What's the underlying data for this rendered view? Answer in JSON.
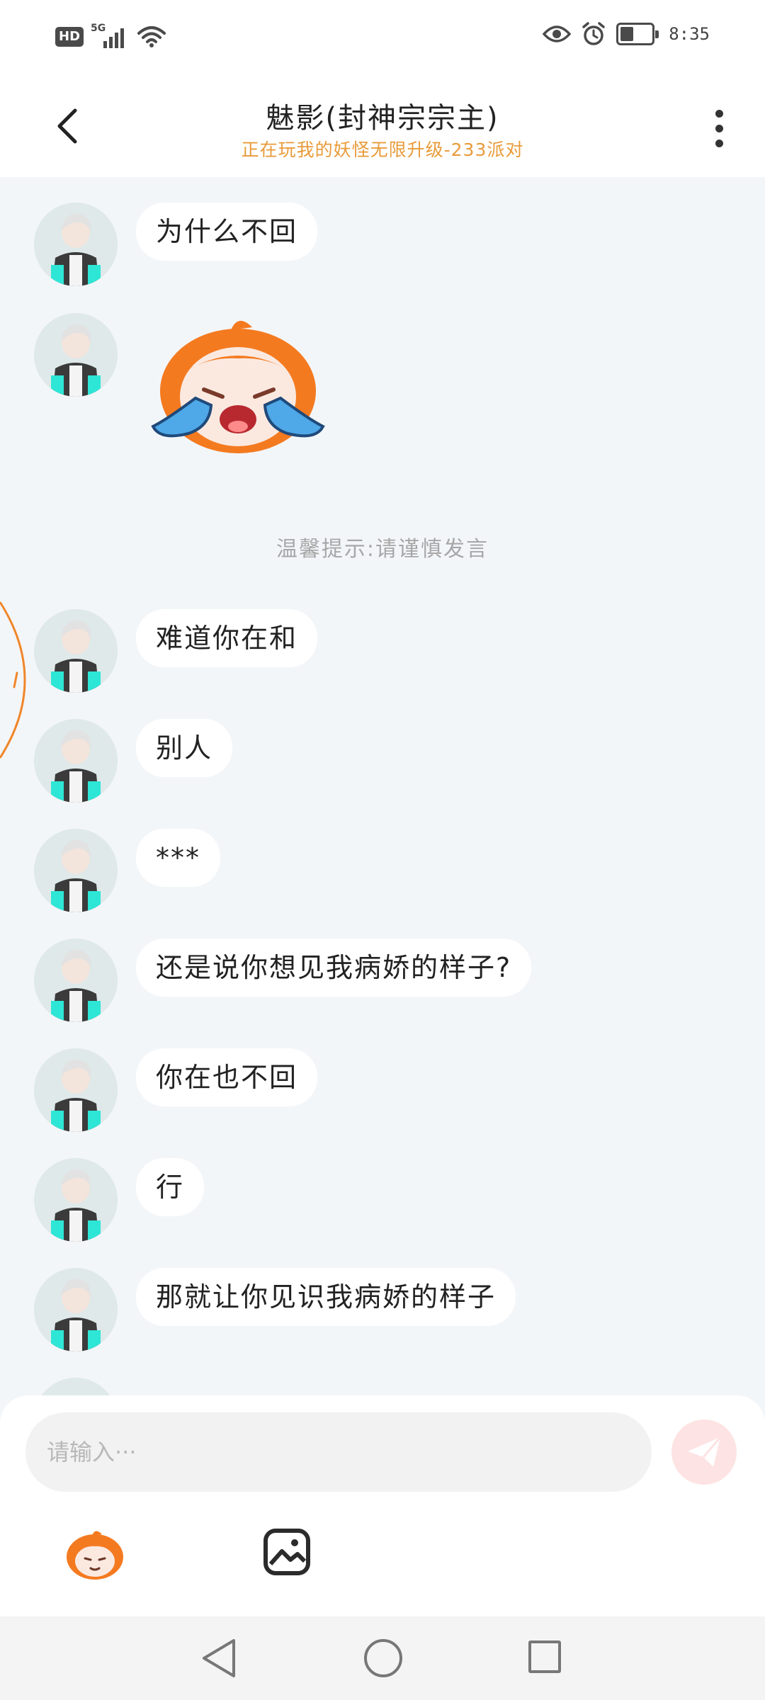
{
  "status_bar": {
    "hd": "HD",
    "network": "5G",
    "time": "8:35"
  },
  "header": {
    "title": "魅影(封神宗宗主)",
    "subtitle": "正在玩我的妖怪无限升级-233派对"
  },
  "notice": "温馨提示:请谨慎发言",
  "messages": [
    {
      "type": "text",
      "text": "为什么不回"
    },
    {
      "type": "sticker",
      "sticker": "crying-sticker"
    },
    {
      "type": "text",
      "text": "难道你在和"
    },
    {
      "type": "text",
      "text": "别人"
    },
    {
      "type": "text",
      "text": "***"
    },
    {
      "type": "text",
      "text": "还是说你想见我病娇的样子?"
    },
    {
      "type": "text",
      "text": "你在也不回"
    },
    {
      "type": "text",
      "text": "行"
    },
    {
      "type": "text",
      "text": "那就让你见识我病娇的样子"
    }
  ],
  "input": {
    "placeholder": "请输入···",
    "value": ""
  },
  "colors": {
    "accent": "#e89b3a",
    "background": "#f3f6f9",
    "send_button": "#fde3e3"
  },
  "icons": {
    "back": "back-arrow-icon",
    "more": "more-vertical-icon",
    "send": "send-plane-icon",
    "emoji": "emoji-mascot-icon",
    "image": "image-picker-icon"
  }
}
